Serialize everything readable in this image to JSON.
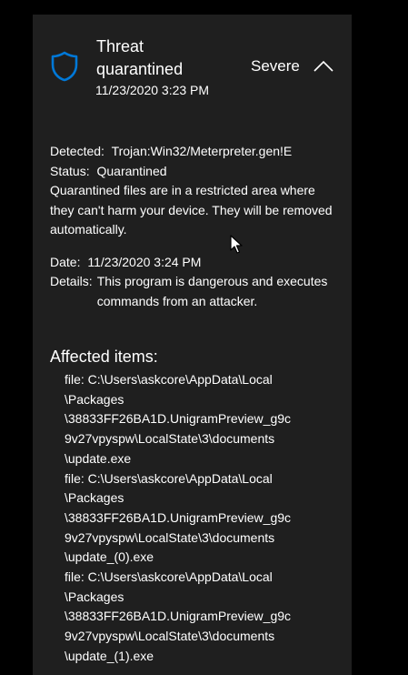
{
  "header": {
    "title": "Threat quarantined",
    "timestamp": "11/23/2020 3:23 PM",
    "severity": "Severe"
  },
  "details": {
    "detected_label": "Detected:",
    "detected_value": "Trojan:Win32/Meterpreter.gen!E",
    "status_label": "Status:",
    "status_value": "Quarantined",
    "note": "Quarantined files are in a restricted area where they can't harm your device. They will be removed automatically.",
    "date_label": "Date:",
    "date_value": "11/23/2020 3:24 PM",
    "details_label": "Details:",
    "details_value": "This program is dangerous and executes commands from an attacker."
  },
  "affected": {
    "title": "Affected items:",
    "lines": [
      "file: C:\\Users\\askcore\\AppData\\Local",
      "\\Packages",
      "\\38833FF26BA1D.UnigramPreview_g9c",
      "9v27vpyspw\\LocalState\\3\\documents",
      "\\update.exe",
      "file: C:\\Users\\askcore\\AppData\\Local",
      "\\Packages",
      "\\38833FF26BA1D.UnigramPreview_g9c",
      "9v27vpyspw\\LocalState\\3\\documents",
      "\\update_(0).exe",
      "file: C:\\Users\\askcore\\AppData\\Local",
      "\\Packages",
      "\\38833FF26BA1D.UnigramPreview_g9c",
      "9v27vpyspw\\LocalState\\3\\documents",
      "\\update_(1).exe"
    ]
  },
  "icons": {
    "shield": "shield-icon",
    "chevron": "chevron-up-icon",
    "cursor": "mouse-cursor-icon"
  },
  "colors": {
    "panel_background": "#1f1f1f",
    "page_background": "#000000",
    "shield_blue": "#0078d7",
    "text": "#ffffff"
  }
}
